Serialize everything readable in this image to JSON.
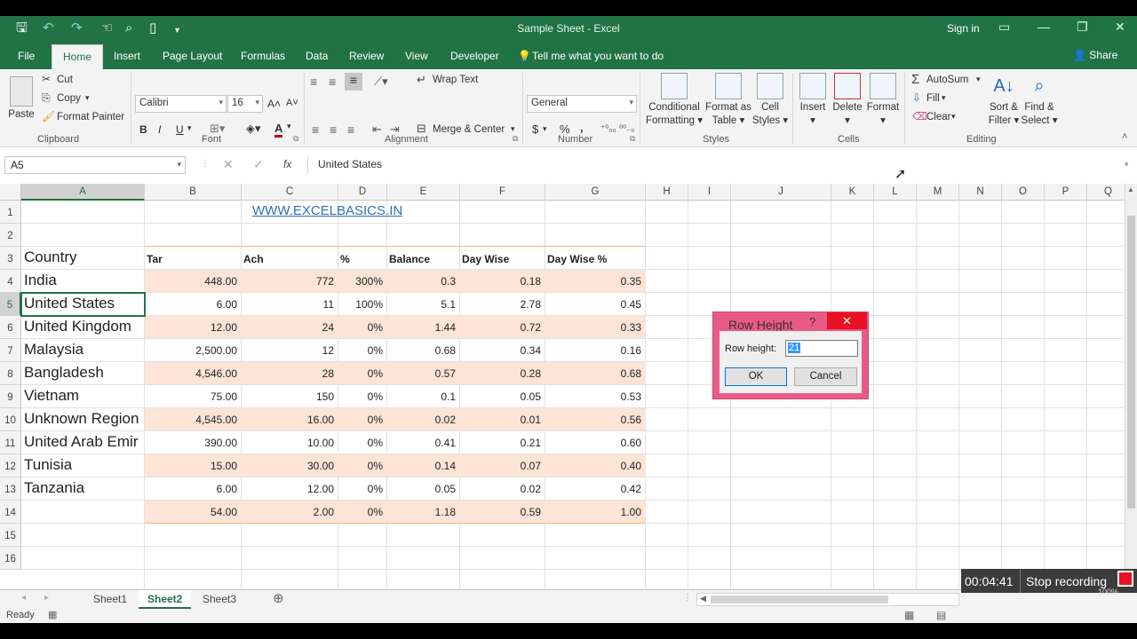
{
  "window": {
    "title": "Sample Sheet - Excel",
    "sign_in": "Sign in"
  },
  "menu_tabs": [
    "File",
    "Home",
    "Insert",
    "Page Layout",
    "Formulas",
    "Data",
    "Review",
    "View",
    "Developer"
  ],
  "tell_me": "Tell me what you want to do",
  "share": "Share",
  "ribbon": {
    "clipboard": {
      "paste": "Paste",
      "cut": "Cut",
      "copy": "Copy",
      "format_painter": "Format Painter",
      "label": "Clipboard"
    },
    "font": {
      "name": "Calibri",
      "size": "16",
      "bold": "B",
      "italic": "I",
      "underline": "U",
      "label": "Font"
    },
    "alignment": {
      "wrap_text": "Wrap Text",
      "merge_center": "Merge & Center",
      "label": "Alignment"
    },
    "number": {
      "format": "General",
      "currency": "$",
      "percent": "%",
      "comma": ",",
      "label": "Number"
    },
    "styles": {
      "conditional": [
        "Conditional",
        "Formatting"
      ],
      "format_table": [
        "Format as",
        "Table"
      ],
      "cell_styles": [
        "Cell",
        "Styles"
      ],
      "label": "Styles"
    },
    "cells": {
      "insert": "Insert",
      "delete": "Delete",
      "format": "Format",
      "label": "Cells"
    },
    "editing": {
      "autosum": "AutoSum",
      "fill": "Fill",
      "clear": "Clear",
      "sort": [
        "Sort &",
        "Filter"
      ],
      "find": [
        "Find &",
        "Select"
      ],
      "label": "Editing"
    }
  },
  "formula_bar": {
    "name_box": "A5",
    "fx": "fx",
    "value": "United States"
  },
  "columns": [
    "A",
    "B",
    "C",
    "D",
    "E",
    "F",
    "G",
    "H",
    "I",
    "J",
    "K",
    "L",
    "M",
    "N",
    "O",
    "P",
    "Q"
  ],
  "rows": [
    "1",
    "2",
    "3",
    "4",
    "5",
    "6",
    "7",
    "8",
    "9",
    "10",
    "11",
    "12",
    "13",
    "14",
    "15",
    "16"
  ],
  "sheet": {
    "link": "WWW.EXCELBASICS.IN",
    "header_country": "Country",
    "headers": [
      "Tar",
      "Ach",
      "%",
      "Balance",
      "Day Wise",
      "Day Wise %"
    ],
    "data": [
      {
        "country": "India",
        "vals": [
          "448.00",
          "772",
          "300%",
          "0.3",
          "0.18",
          "0.35"
        ]
      },
      {
        "country": "United States",
        "vals": [
          "6.00",
          "11",
          "100%",
          "5.1",
          "2.78",
          "0.45"
        ]
      },
      {
        "country": "United Kingdom",
        "vals": [
          "12.00",
          "24",
          "0%",
          "1.44",
          "0.72",
          "0.33"
        ]
      },
      {
        "country": "Malaysia",
        "vals": [
          "2,500.00",
          "12",
          "0%",
          "0.68",
          "0.34",
          "0.16"
        ]
      },
      {
        "country": "Bangladesh",
        "vals": [
          "4,546.00",
          "28",
          "0%",
          "0.57",
          "0.28",
          "0.68"
        ]
      },
      {
        "country": "Vietnam",
        "vals": [
          "75.00",
          "150",
          "0%",
          "0.1",
          "0.05",
          "0.53"
        ]
      },
      {
        "country": "Unknown Region",
        "vals": [
          "4,545.00",
          "16.00",
          "0%",
          "0.02",
          "0.01",
          "0.56"
        ]
      },
      {
        "country": "United Arab Emir",
        "vals": [
          "390.00",
          "10.00",
          "0%",
          "0.41",
          "0.21",
          "0.60"
        ]
      },
      {
        "country": "Tunisia",
        "vals": [
          "15.00",
          "30.00",
          "0%",
          "0.14",
          "0.07",
          "0.40"
        ]
      },
      {
        "country": "Tanzania",
        "vals": [
          "6.00",
          "12.00",
          "0%",
          "0.05",
          "0.02",
          "0.42"
        ]
      },
      {
        "country": "",
        "vals": [
          "54.00",
          "2.00",
          "0%",
          "1.18",
          "0.59",
          "1.00"
        ]
      }
    ]
  },
  "sheet_tabs": [
    "Sheet1",
    "Sheet2",
    "Sheet3"
  ],
  "active_sheet": "Sheet2",
  "status": "Ready",
  "dialog": {
    "title": "Row Height",
    "help": "?",
    "close": "✕",
    "label": "Row height:",
    "value": "21",
    "ok": "OK",
    "cancel": "Cancel"
  },
  "recording": {
    "time": "00:04:41",
    "stop": "Stop recording",
    "zoom": "100%"
  },
  "colors": {
    "accent": "#217346",
    "band": "#fce4d6",
    "dialog_border": "#ea5a86",
    "link": "#2f6fba"
  }
}
